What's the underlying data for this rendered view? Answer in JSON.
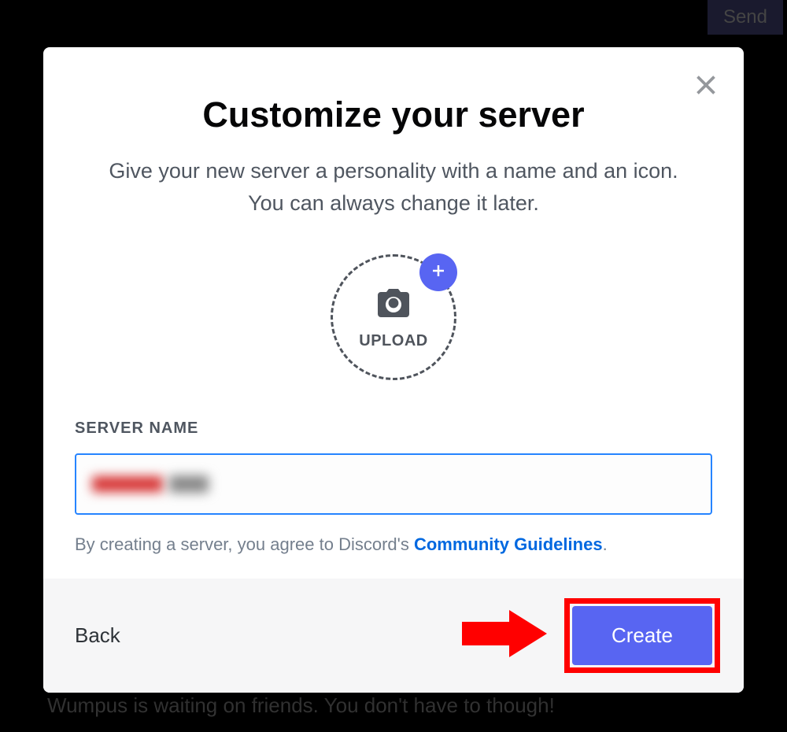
{
  "background": {
    "send_label": "Send",
    "wumpus_text": "Wumpus is waiting on friends. You don't have to though!"
  },
  "modal": {
    "title": "Customize your server",
    "subtitle": "Give your new server a personality with a name and an icon. You can always change it later.",
    "upload_label": "UPLOAD",
    "field_label": "SERVER NAME",
    "server_name_value": "",
    "disclaimer_prefix": "By creating a server, you agree to Discord's ",
    "disclaimer_link": "Community Guidelines",
    "disclaimer_suffix": ".",
    "back_label": "Back",
    "create_label": "Create"
  },
  "annotation": {
    "type": "arrow-highlight",
    "target": "create-button",
    "color": "#ff0000"
  }
}
